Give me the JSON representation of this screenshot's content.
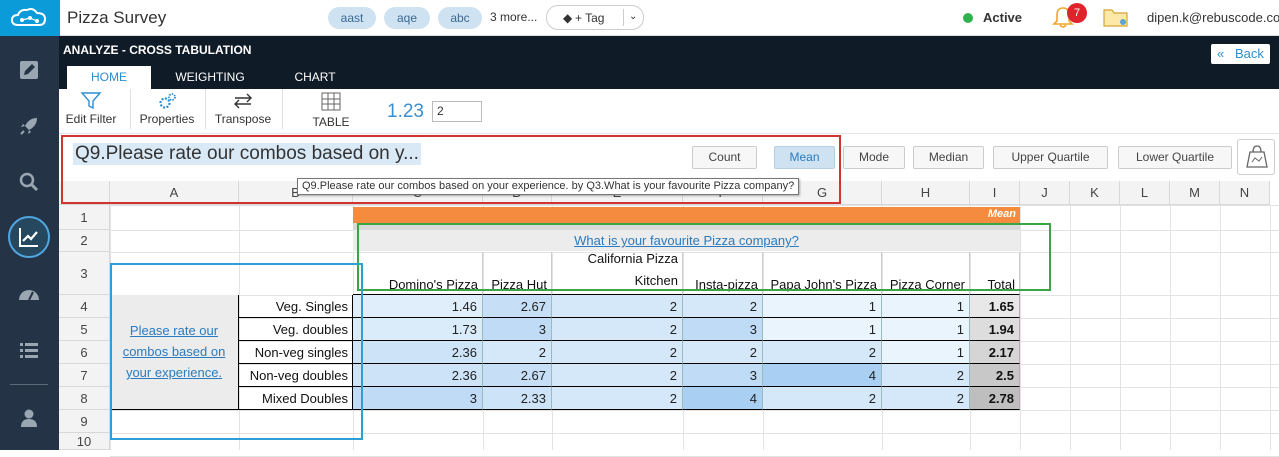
{
  "app": {
    "title": "Pizza Survey"
  },
  "tags": {
    "pills": [
      "aast",
      "aqe",
      "abc"
    ],
    "more": "3 more...",
    "tag_button": "+ Tag"
  },
  "user": {
    "status": "Active",
    "notifications": "7",
    "email": "dipen.k@rebuscode.com"
  },
  "page": {
    "section_title": "ANALYZE - CROSS TABULATION",
    "back": "Back"
  },
  "tabs": [
    "HOME",
    "WEIGHTING",
    "CHART"
  ],
  "toolbar": {
    "edit_filter": "Edit Filter",
    "properties": "Properties",
    "transpose": "Transpose",
    "table": "TABLE",
    "decimals_label": "1.23",
    "decimals_value": "2"
  },
  "question": {
    "title": "Q9.Please rate our combos based on y...",
    "tooltip": "Q9.Please rate our combos based on your experience. by Q3.What is your favourite Pizza company?"
  },
  "stats": [
    "Count",
    "Mean",
    "Mode",
    "Median",
    "Upper Quartile",
    "Lower Quartile"
  ],
  "active_stat": "Mean",
  "columns": [
    "A",
    "B",
    "C",
    "D",
    "E",
    "F",
    "G",
    "H",
    "I",
    "J",
    "K",
    "L",
    "M",
    "N"
  ],
  "rows": [
    "1",
    "2",
    "3",
    "4",
    "5",
    "6",
    "7",
    "8",
    "9",
    "10"
  ],
  "table": {
    "mean_label": "Mean",
    "group_header": "What is your favourite Pizza company?",
    "row_group": "Please rate our combos based on your experience.",
    "col_headers": [
      "Domino's Pizza",
      "Pizza Hut",
      "California Pizza Kitchen",
      "Insta-pizza",
      "Papa John's Pizza",
      "Pizza Corner",
      "Total"
    ],
    "row_labels": [
      "Veg. Singles",
      "Veg. doubles",
      "Non-veg singles",
      "Non-veg doubles",
      "Mixed Doubles"
    ],
    "values": [
      [
        "1.46",
        "2.67",
        "2",
        "2",
        "1",
        "1",
        "1.65"
      ],
      [
        "1.73",
        "3",
        "2",
        "3",
        "1",
        "1",
        "1.94"
      ],
      [
        "2.36",
        "2",
        "2",
        "2",
        "2",
        "1",
        "2.17"
      ],
      [
        "2.36",
        "2.67",
        "2",
        "3",
        "4",
        "2",
        "2.5"
      ],
      [
        "3",
        "2.33",
        "2",
        "4",
        "2",
        "2",
        "2.78"
      ]
    ]
  },
  "colors": {
    "nav_bg": "#243446",
    "header_bg": "#0f1b27",
    "accent": "#2a8fd0",
    "mean_bar": "#f58b3e",
    "heat_low": "#eaf4fd",
    "heat_high": "#a9cff2",
    "total_low": "#eeeeee",
    "total_high": "#b9b9b9"
  }
}
